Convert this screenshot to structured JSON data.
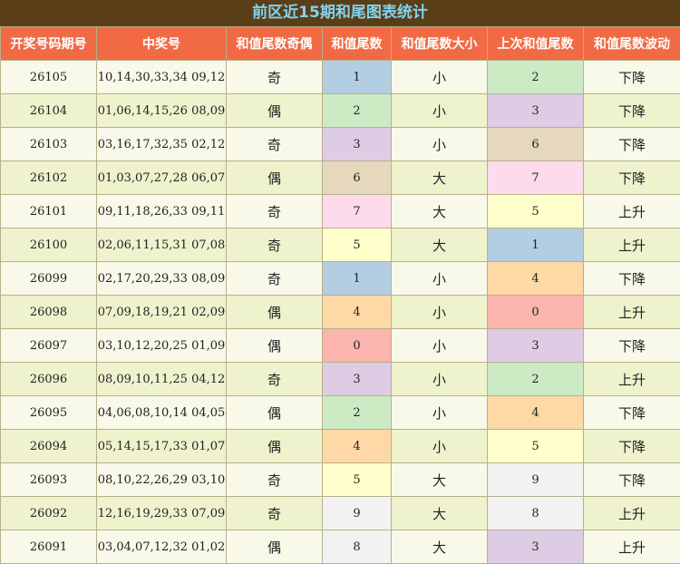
{
  "title": "前区近15期和尾图表统计",
  "headers": [
    "开奖号码期号",
    "中奖号",
    "和值尾数奇偶",
    "和值尾数",
    "和值尾数大小",
    "上次和值尾数",
    "和值尾数波动"
  ],
  "rows": [
    {
      "issue": "26105",
      "numbers": "10,14,30,33,34 09,12",
      "parity": "奇",
      "tail": "1",
      "size": "小",
      "prev": "2",
      "trend": "下降"
    },
    {
      "issue": "26104",
      "numbers": "01,06,14,15,26 08,09",
      "parity": "偶",
      "tail": "2",
      "size": "小",
      "prev": "3",
      "trend": "下降"
    },
    {
      "issue": "26103",
      "numbers": "03,16,17,32,35 02,12",
      "parity": "奇",
      "tail": "3",
      "size": "小",
      "prev": "6",
      "trend": "下降"
    },
    {
      "issue": "26102",
      "numbers": "01,03,07,27,28 06,07",
      "parity": "偶",
      "tail": "6",
      "size": "大",
      "prev": "7",
      "trend": "下降"
    },
    {
      "issue": "26101",
      "numbers": "09,11,18,26,33 09,11",
      "parity": "奇",
      "tail": "7",
      "size": "大",
      "prev": "5",
      "trend": "上升"
    },
    {
      "issue": "26100",
      "numbers": "02,06,11,15,31 07,08",
      "parity": "奇",
      "tail": "5",
      "size": "大",
      "prev": "1",
      "trend": "上升"
    },
    {
      "issue": "26099",
      "numbers": "02,17,20,29,33 08,09",
      "parity": "奇",
      "tail": "1",
      "size": "小",
      "prev": "4",
      "trend": "下降"
    },
    {
      "issue": "26098",
      "numbers": "07,09,18,19,21 02,09",
      "parity": "偶",
      "tail": "4",
      "size": "小",
      "prev": "0",
      "trend": "上升"
    },
    {
      "issue": "26097",
      "numbers": "03,10,12,20,25 01,09",
      "parity": "偶",
      "tail": "0",
      "size": "小",
      "prev": "3",
      "trend": "下降"
    },
    {
      "issue": "26096",
      "numbers": "08,09,10,11,25 04,12",
      "parity": "奇",
      "tail": "3",
      "size": "小",
      "prev": "2",
      "trend": "上升"
    },
    {
      "issue": "26095",
      "numbers": "04,06,08,10,14 04,05",
      "parity": "偶",
      "tail": "2",
      "size": "小",
      "prev": "4",
      "trend": "下降"
    },
    {
      "issue": "26094",
      "numbers": "05,14,15,17,33 01,07",
      "parity": "偶",
      "tail": "4",
      "size": "小",
      "prev": "5",
      "trend": "下降"
    },
    {
      "issue": "26093",
      "numbers": "08,10,22,26,29 03,10",
      "parity": "奇",
      "tail": "5",
      "size": "大",
      "prev": "9",
      "trend": "下降"
    },
    {
      "issue": "26092",
      "numbers": "12,16,19,29,33 07,09",
      "parity": "奇",
      "tail": "9",
      "size": "大",
      "prev": "8",
      "trend": "上升"
    },
    {
      "issue": "26091",
      "numbers": "03,04,07,12,32 01,02",
      "parity": "偶",
      "tail": "8",
      "size": "大",
      "prev": "3",
      "trend": "上升"
    }
  ],
  "colors": {
    "title_bg": "#5a3e18",
    "title_text": "#7fd4f0",
    "header_bg": "#f26a44",
    "row_odd": "#f8f9e9",
    "row_even": "#eef3cd"
  }
}
